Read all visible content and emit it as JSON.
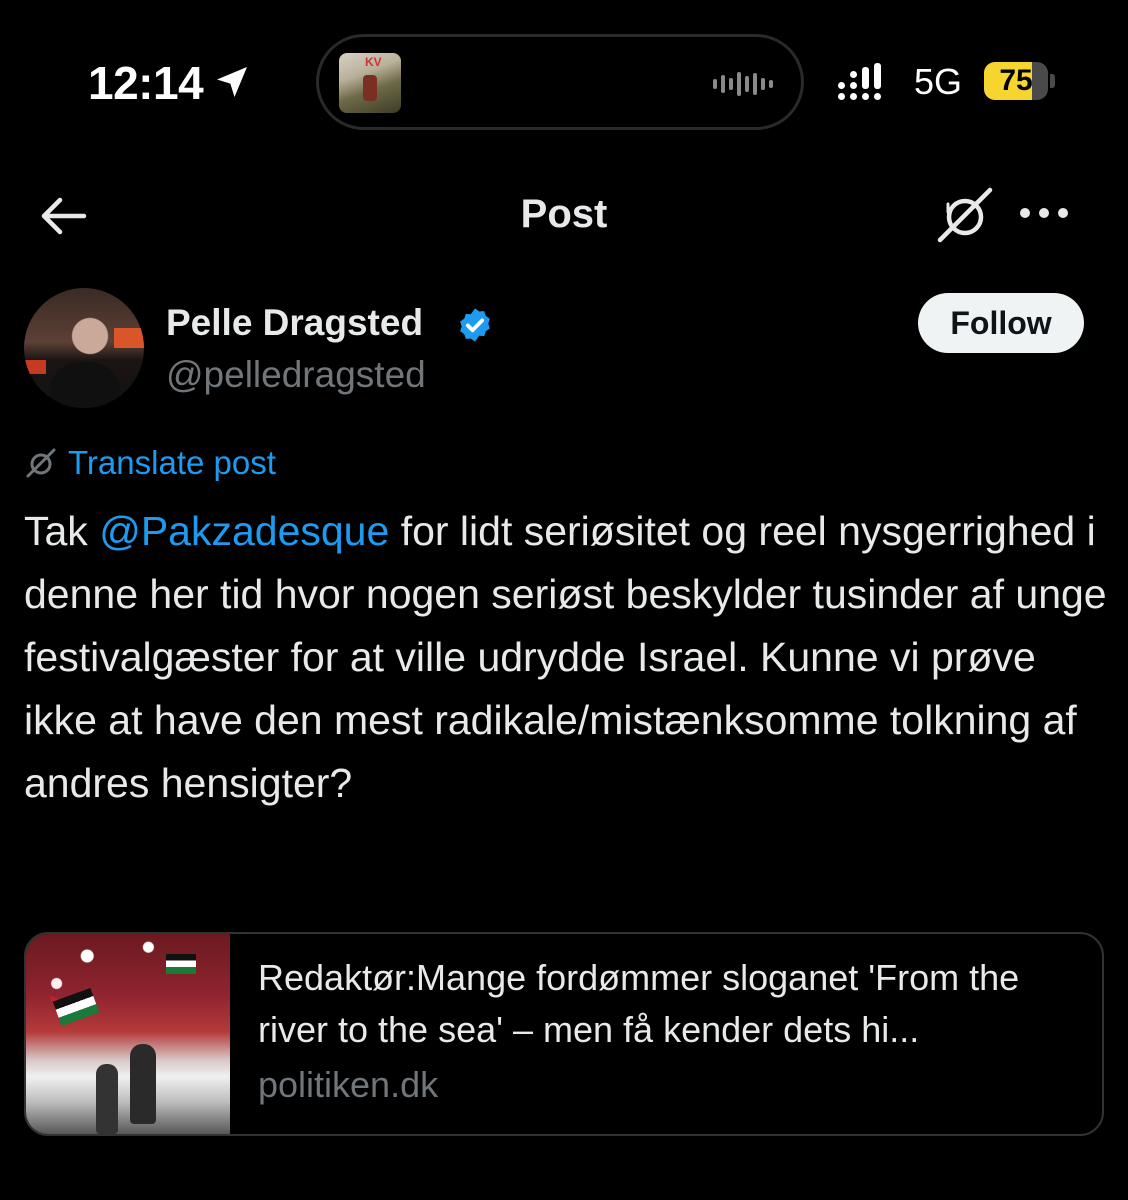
{
  "status_bar": {
    "time": "12:14",
    "network": "5G",
    "battery_level": 75,
    "battery_label": "75",
    "battery_color": "#f7d52f",
    "island_art_label": "KV"
  },
  "nav": {
    "title": "Post"
  },
  "author": {
    "name": "Pelle Dragsted",
    "handle": "@pelledragsted",
    "verified_color": "#1d9bf0"
  },
  "follow_label": "Follow",
  "translate_label": "Translate post",
  "post": {
    "text_before": "Tak ",
    "mention": "@Pakzadesque",
    "text_after": " for lidt seriøsitet og reel nysgerrighed i denne her tid hvor nogen seriøst beskylder tusinder af unge festivalgæster for at ville udrydde Israel. Kunne vi prøve ikke at have den mest radikale/mistænksomme tolkning af andres hensigter?"
  },
  "link_card": {
    "title": "Redaktør:Mange fordømmer sloganet 'From the river to the sea' – men få kender dets hi...",
    "domain": "politiken.dk"
  },
  "colors": {
    "background": "#000000",
    "text": "#e7e9ea",
    "secondary": "#71767b",
    "link": "#1d9bf0"
  }
}
